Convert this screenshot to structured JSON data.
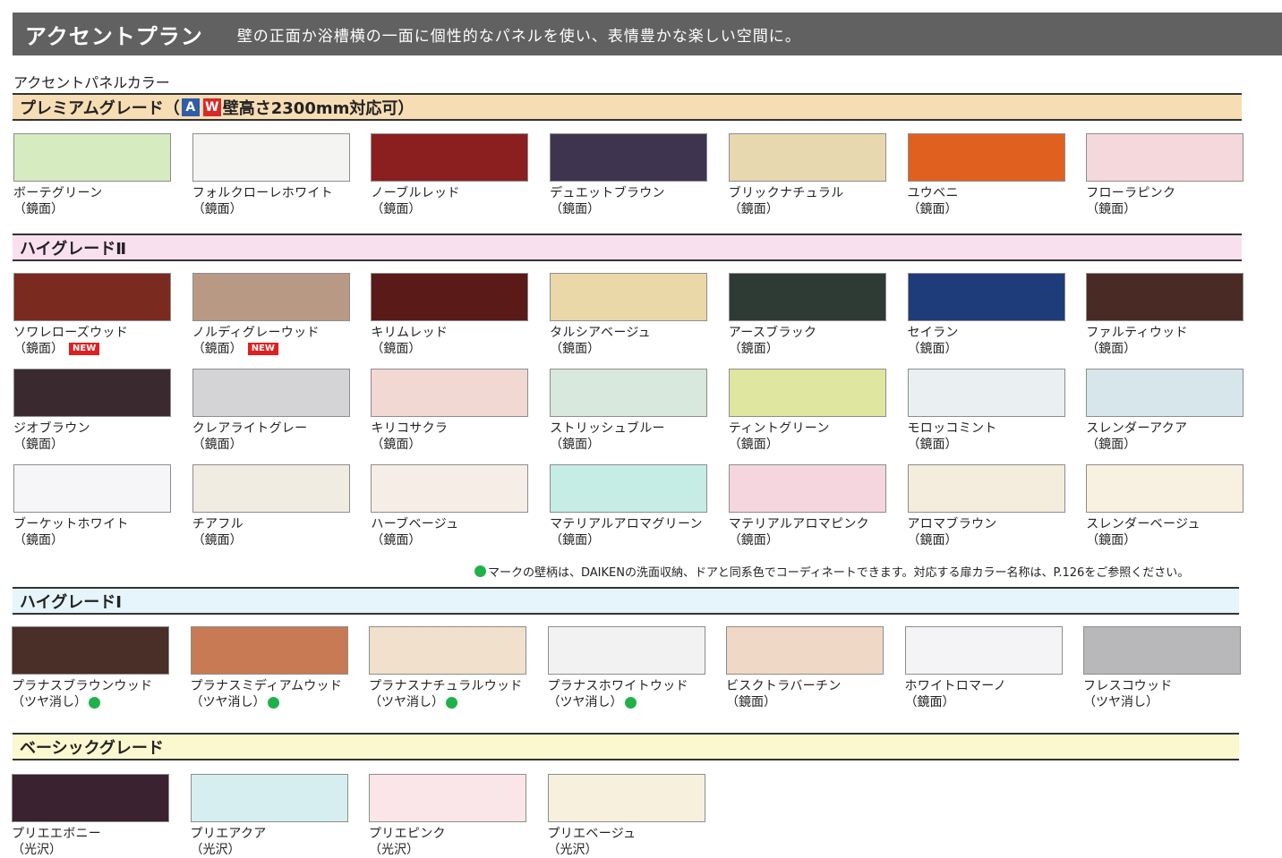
{
  "header": {
    "title": "アクセントプラン",
    "subtitle": "壁の正面か浴槽横の一面に個性的なパネルを使い、表情豊かな楽しい空間に。"
  },
  "panel_heading": "アクセントパネルカラー",
  "premium": {
    "label": "プレミアムグレード（",
    "tag_a": "A",
    "tag_w": "W",
    "label_suffix": "壁高さ2300mm対応可）",
    "colors": [
      "#d6ebbf",
      "#f4f4f2",
      "#8b1e1e",
      "#3e3450",
      "#e8d8b0",
      "#e06020",
      "#f4d8dc"
    ],
    "items": [
      {
        "name": "ボーテグリーン",
        "finish": "（鏡面）"
      },
      {
        "name": "フォルクローレホワイト",
        "finish": "（鏡面）"
      },
      {
        "name": "ノーブルレッド",
        "finish": "（鏡面）"
      },
      {
        "name": "デュエットブラウン",
        "finish": "（鏡面）"
      },
      {
        "name": "ブリックナチュラル",
        "finish": "（鏡面）"
      },
      {
        "name": "ユウベニ",
        "finish": "（鏡面）"
      },
      {
        "name": "フローラピンク",
        "finish": "（鏡面）"
      }
    ]
  },
  "high2": {
    "label": "ハイグレードⅡ",
    "colors": [
      "#7a2a1e",
      "#b89a84",
      "#5a1a18",
      "#ead8a8",
      "#2e3a34",
      "#1f3c7a",
      "#4a2a24",
      "#3a2a30",
      "#d4d4d6",
      "#f2d8d2",
      "#d8e8dc",
      "#dfe6a0",
      "#eaeff2",
      "#d6e6ea",
      "#f6f6f8",
      "#f1ece2",
      "#f6eee6",
      "#c6ece6",
      "#f6d6de",
      "#f4ecdc",
      "#f8f0e0"
    ],
    "items": [
      {
        "name": "ソワレローズウッド",
        "finish": "（鏡面）",
        "new": "NEW"
      },
      {
        "name": "ノルディグレーウッド",
        "finish": "（鏡面）",
        "new": "NEW"
      },
      {
        "name": "キリムレッド",
        "finish": "（鏡面）"
      },
      {
        "name": "タルシアベージュ",
        "finish": "（鏡面）"
      },
      {
        "name": "アースブラック",
        "finish": "（鏡面）"
      },
      {
        "name": "セイラン",
        "finish": "（鏡面）"
      },
      {
        "name": "ファルティウッド",
        "finish": "（鏡面）"
      },
      {
        "name": "ジオブラウン",
        "finish": "（鏡面）"
      },
      {
        "name": "クレアライトグレー",
        "finish": "（鏡面）"
      },
      {
        "name": "キリコサクラ",
        "finish": "（鏡面）"
      },
      {
        "name": "ストリッシュブルー",
        "finish": "（鏡面）"
      },
      {
        "name": "ティントグリーン",
        "finish": "（鏡面）"
      },
      {
        "name": "モロッコミント",
        "finish": "（鏡面）"
      },
      {
        "name": "スレンダーアクア",
        "finish": "（鏡面）"
      },
      {
        "name": "ブーケットホワイト",
        "finish": "（鏡面）"
      },
      {
        "name": "チアフル",
        "finish": "（鏡面）"
      },
      {
        "name": "ハーブベージュ",
        "finish": "（鏡面）"
      },
      {
        "name": "マテリアルアロマグリーン",
        "finish": "（鏡面）"
      },
      {
        "name": "マテリアルアロマピンク",
        "finish": "（鏡面）"
      },
      {
        "name": "アロマブラウン",
        "finish": "（鏡面）"
      },
      {
        "name": "スレンダーベージュ",
        "finish": "（鏡面）"
      }
    ]
  },
  "note": "マークの壁柄は、DAIKENの洗面収納、ドアと同系色でコーディネートできます。対応する扉カラー名称は、P.126をご参照ください。",
  "high1": {
    "label": "ハイグレードⅠ",
    "colors": [
      "#4a2e28",
      "#c87a54",
      "#f0e0cc",
      "#f2f2f2",
      "#efd8c6",
      "#f4f4f6",
      "#b8b8ba"
    ],
    "items": [
      {
        "name": "プラナスブラウンウッド",
        "finish": "（ツヤ消し）",
        "dot": true
      },
      {
        "name": "プラナスミディアムウッド",
        "finish": "（ツヤ消し）",
        "dot": true
      },
      {
        "name": "プラナスナチュラルウッド",
        "finish": "（ツヤ消し）",
        "dot": true
      },
      {
        "name": "プラナスホワイトウッド",
        "finish": "（ツヤ消し）",
        "dot": true
      },
      {
        "name": "ビスクトラバーチン",
        "finish": "（鏡面）"
      },
      {
        "name": "ホワイトロマーノ",
        "finish": "（鏡面）"
      },
      {
        "name": "フレスコウッド",
        "finish": "（ツヤ消し）"
      }
    ]
  },
  "basic": {
    "label": "ベーシックグレード",
    "colors": [
      "#3a2230",
      "#d6eef0",
      "#fae6e8",
      "#f6f0dc"
    ],
    "items": [
      {
        "name": "プリエエボニー",
        "finish": "（光沢）"
      },
      {
        "name": "プリエアクア",
        "finish": "（光沢）"
      },
      {
        "name": "プリエピンク",
        "finish": "（光沢）"
      },
      {
        "name": "プリエベージュ",
        "finish": "（光沢）"
      }
    ]
  },
  "band_colors": {
    "premium": "#f6ddb4",
    "high2": "#f9e0ee",
    "high1": "#e6f4fb",
    "basic": "#fbf7cf"
  }
}
